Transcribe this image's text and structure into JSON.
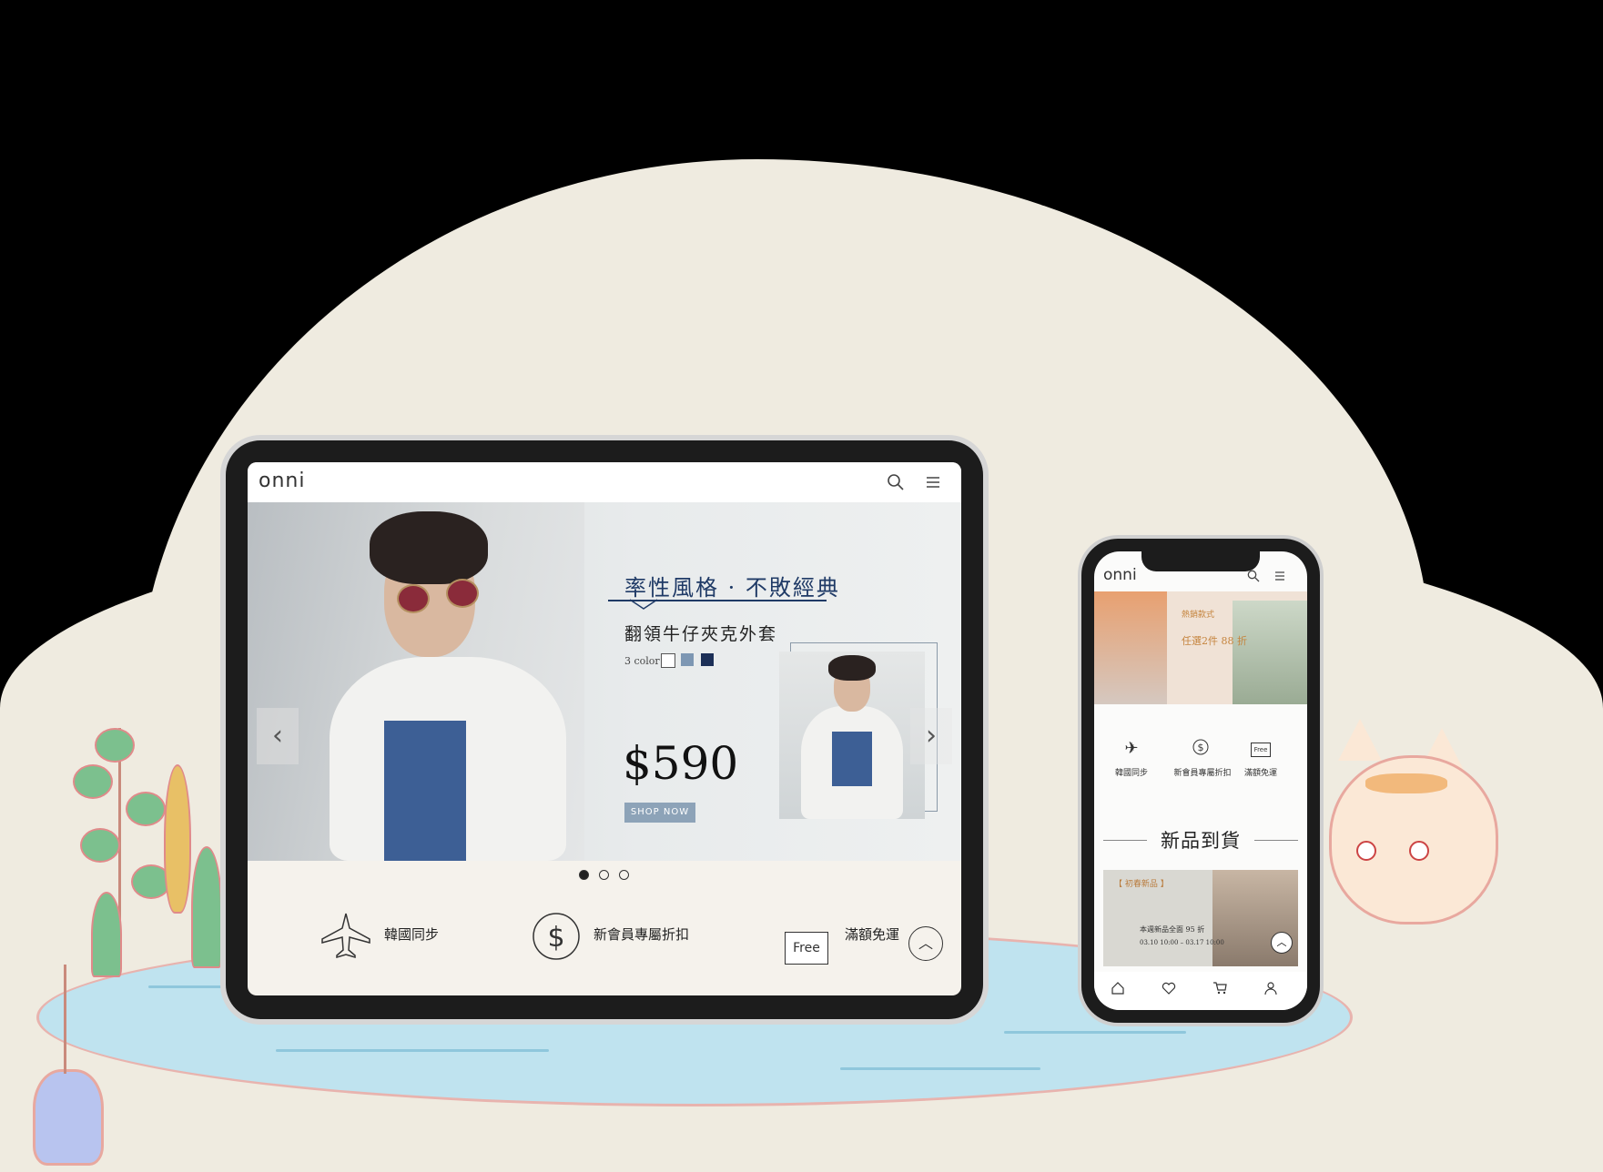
{
  "tablet": {
    "brand": "onni",
    "hero": {
      "slogan": "率性風格 · 不敗經典",
      "product_name": "翻領牛仔夾克外套",
      "color_label": "3 color",
      "swatch_colors": [
        "#ffffff",
        "#7d97b3",
        "#1c2f57"
      ],
      "price": "$590",
      "shop_button": "SHOP NOW"
    },
    "features": [
      {
        "icon": "airplane-icon",
        "label": "韓國同步"
      },
      {
        "icon": "dollar-coin-icon",
        "label": "新會員專屬折扣"
      },
      {
        "icon": "free-shipping-icon",
        "label": "滿額免運",
        "icon_text": "Free"
      }
    ]
  },
  "phone": {
    "brand": "onni",
    "banner": {
      "text1": "熱銷款式",
      "text2": "任選2件 88 折"
    },
    "features": [
      {
        "icon": "airplane-icon",
        "label": "韓國同步"
      },
      {
        "icon": "dollar-coin-icon",
        "label": "新會員專屬折扣"
      },
      {
        "icon": "free-shipping-icon",
        "label": "滿額免運",
        "icon_text": "Free"
      }
    ],
    "section_title": "新品到貨",
    "card": {
      "tag": "【 初春新品 】",
      "line1": "本週新品全面 95 折",
      "line2": "03.10 10:00 – 03.17 10:00"
    }
  },
  "colors": {
    "brand_navy": "#1f3a66",
    "background": "#efebe0",
    "pond": "#bfe3ef",
    "accent_orange": "#c5843e"
  }
}
